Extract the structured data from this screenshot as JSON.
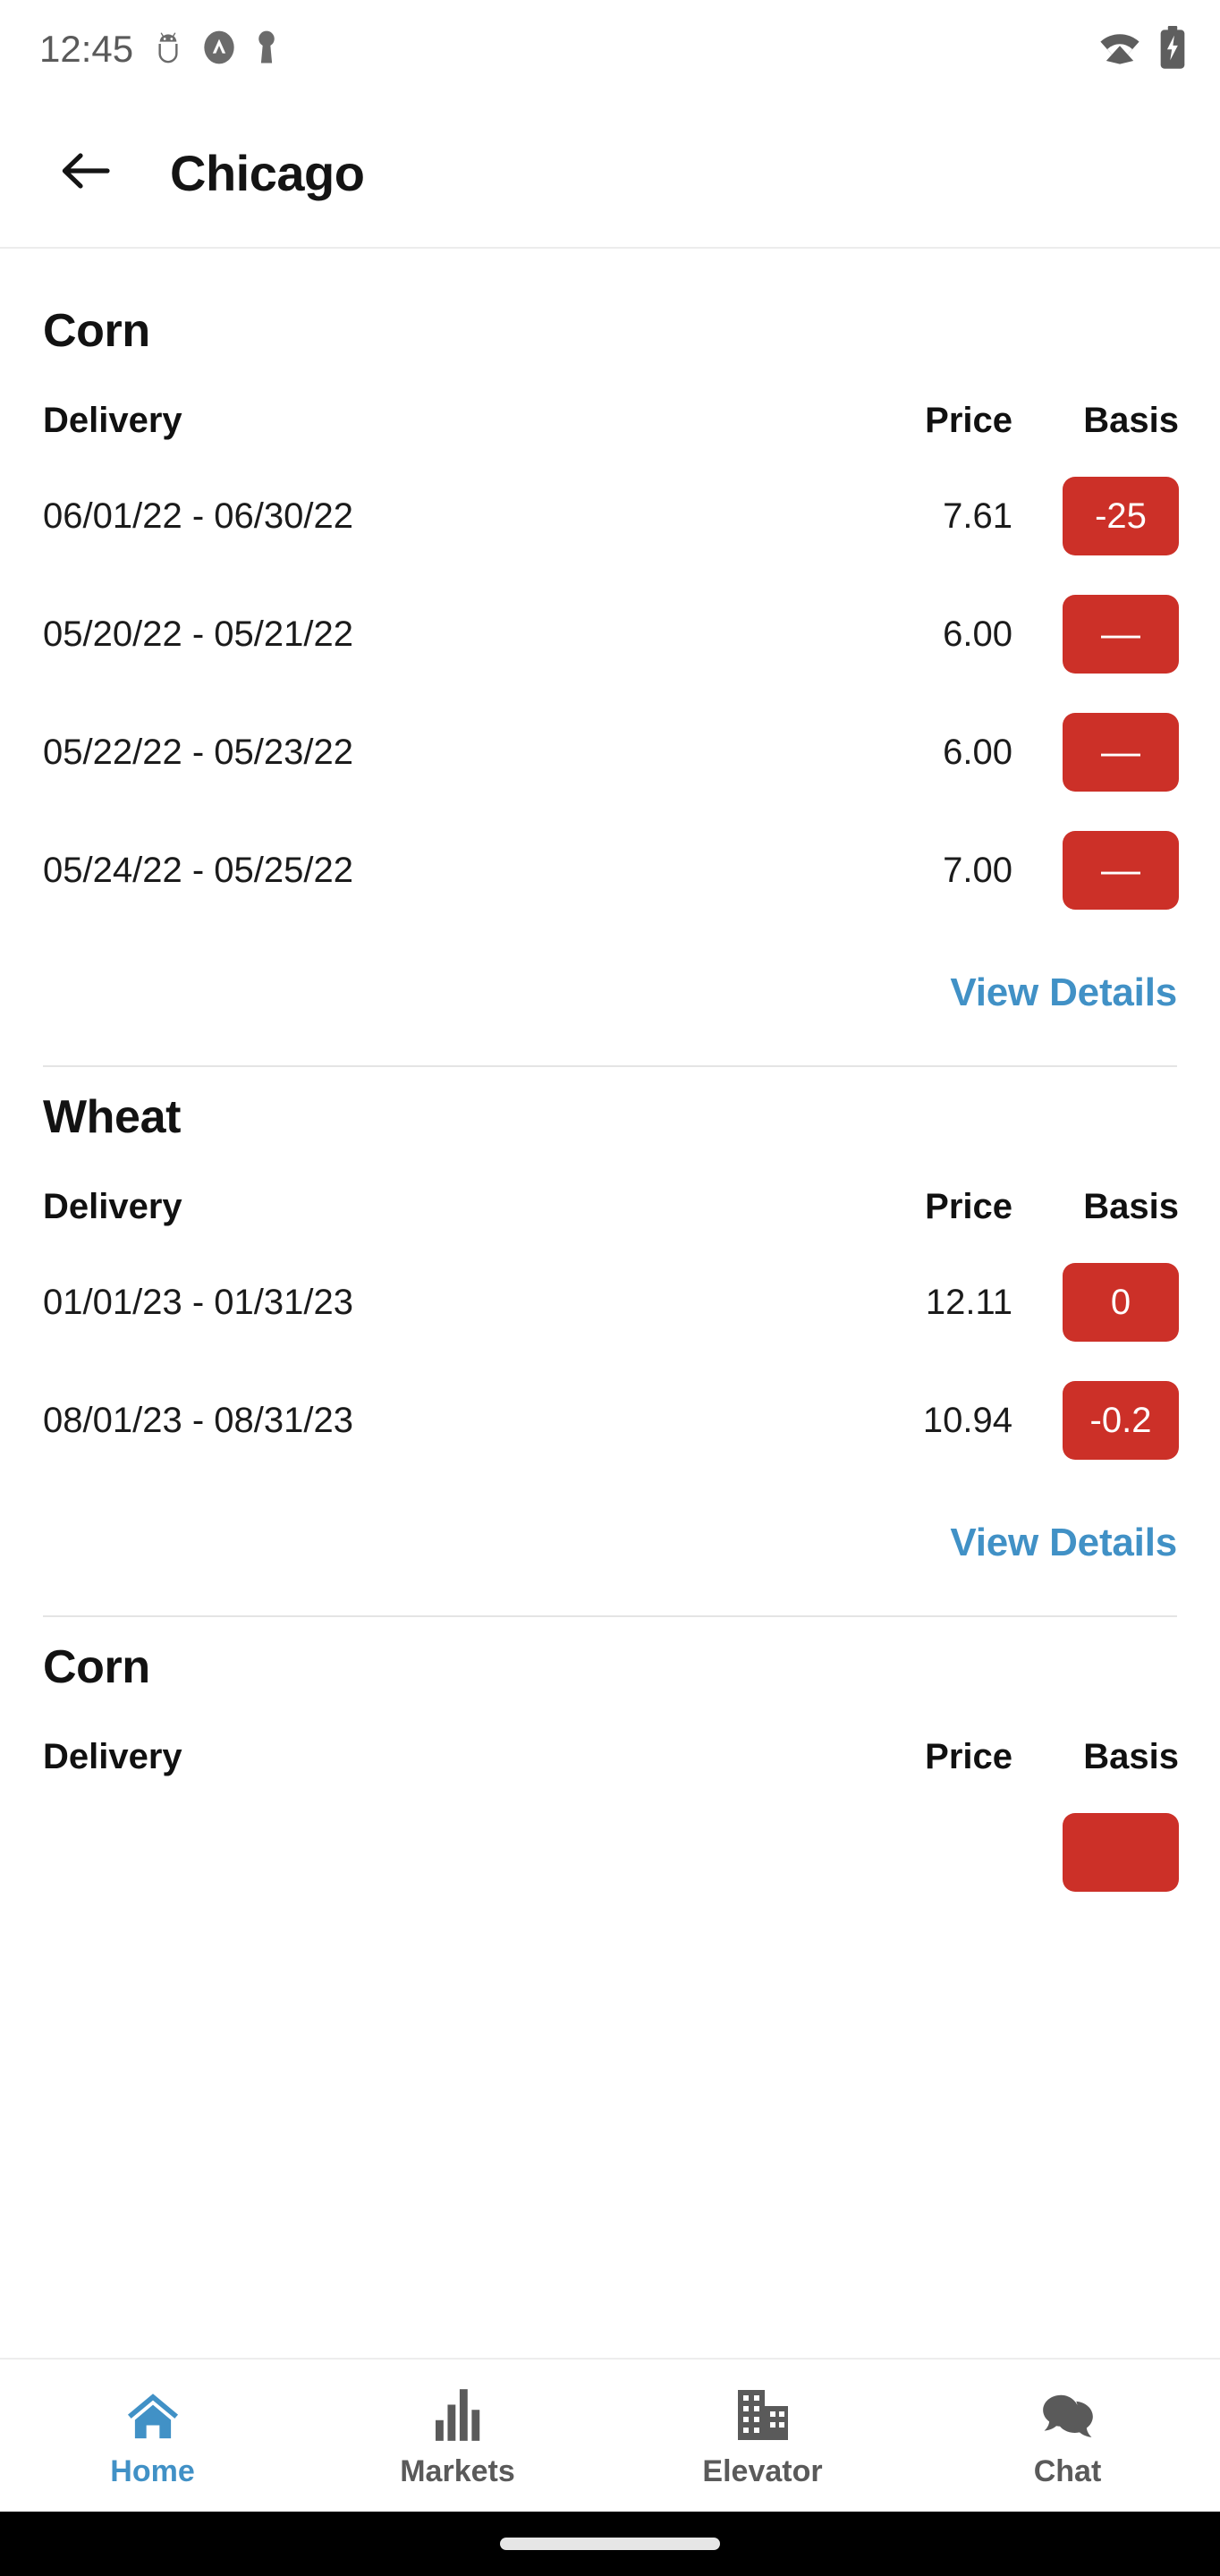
{
  "status_bar": {
    "time": "12:45",
    "icons_left": [
      "android-debug-icon",
      "avast-icon",
      "vpn-key-icon"
    ],
    "icons_right": [
      "wifi-icon",
      "battery-charging-icon"
    ]
  },
  "app_bar": {
    "back_icon": "arrow-back-icon",
    "title": "Chicago"
  },
  "colors": {
    "accent_blue": "#4191c6",
    "badge_red": "#cc3028",
    "text_primary": "#121212",
    "divider": "#e4e4e4",
    "nav_inactive": "#5a5a5a"
  },
  "sections": [
    {
      "commodity": "Corn",
      "columns": [
        "Delivery",
        "Price",
        "Basis"
      ],
      "rows": [
        {
          "delivery": "06/01/22 - 06/30/22",
          "price": "7.61",
          "basis": "-25"
        },
        {
          "delivery": "05/20/22 - 05/21/22",
          "price": "6.00",
          "basis": "—"
        },
        {
          "delivery": "05/22/22 - 05/23/22",
          "price": "6.00",
          "basis": "—"
        },
        {
          "delivery": "05/24/22 - 05/25/22",
          "price": "7.00",
          "basis": "—"
        }
      ],
      "view_details_label": "View Details"
    },
    {
      "commodity": "Wheat",
      "columns": [
        "Delivery",
        "Price",
        "Basis"
      ],
      "rows": [
        {
          "delivery": "01/01/23 - 01/31/23",
          "price": "12.11",
          "basis": "0"
        },
        {
          "delivery": "08/01/23 - 08/31/23",
          "price": "10.94",
          "basis": "-0.2"
        }
      ],
      "view_details_label": "View Details"
    },
    {
      "commodity": "Corn",
      "columns": [
        "Delivery",
        "Price",
        "Basis"
      ],
      "rows": [],
      "view_details_label": ""
    }
  ],
  "bottom_nav": {
    "items": [
      {
        "label": "Home",
        "icon": "home-icon",
        "active": true
      },
      {
        "label": "Markets",
        "icon": "bar-chart-icon",
        "active": false
      },
      {
        "label": "Elevator",
        "icon": "buildings-icon",
        "active": false
      },
      {
        "label": "Chat",
        "icon": "chat-bubbles-icon",
        "active": false
      }
    ]
  }
}
